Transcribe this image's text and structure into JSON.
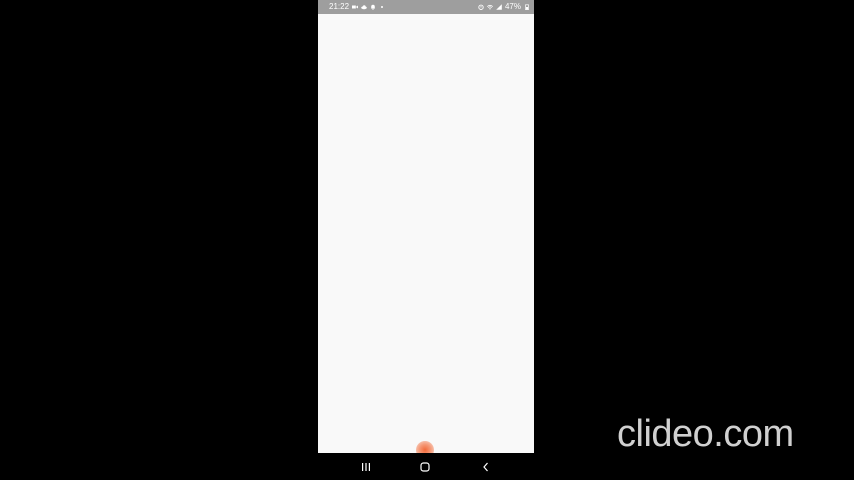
{
  "status_bar": {
    "time": "21:22",
    "battery": "47%",
    "left_icons": [
      "video-camera-icon",
      "cloud-icon",
      "notification-bell-icon",
      "dot-icon"
    ],
    "right_icons": [
      "alarm-icon",
      "wifi-icon",
      "signal-icon"
    ]
  },
  "navigation": {
    "recents_icon": "recents-icon",
    "home_icon": "home-icon",
    "back_icon": "back-icon"
  },
  "watermark": {
    "text": "clideo.com"
  },
  "colors": {
    "background": "#000000",
    "screen": "#f9f9f9",
    "status_bar": "#9e9e9e",
    "touch_indicator": "#f26a3a",
    "watermark": "#d0d0d0"
  }
}
